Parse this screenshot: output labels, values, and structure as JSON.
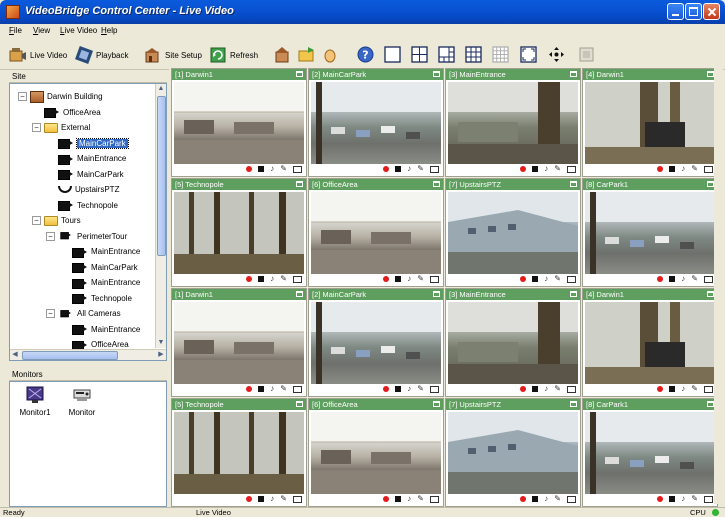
{
  "window": {
    "title": "VideoBridge Control Center - Live Video"
  },
  "menu": [
    {
      "label": "File",
      "underline": "F",
      "rest": "ile"
    },
    {
      "label": "View",
      "underline": "V",
      "rest": "iew"
    },
    {
      "label": "Live Video",
      "underline": "L",
      "rest": "ive Video"
    },
    {
      "label": "Help",
      "underline": "H",
      "rest": "elp"
    }
  ],
  "toolbar": {
    "live_video": "Live Video",
    "playback": "Playback",
    "site_setup": "Site Setup",
    "refresh": "Refresh"
  },
  "site_panel": {
    "header": "Site",
    "tree": [
      {
        "label": "Darwin Building",
        "level": 0,
        "kind": "building",
        "expander": "−"
      },
      {
        "label": "OfficeArea",
        "level": 1,
        "kind": "camera"
      },
      {
        "label": "External",
        "level": 1,
        "kind": "folder",
        "expander": "−"
      },
      {
        "label": "MainCarPark",
        "level": 2,
        "kind": "camera",
        "selected": true
      },
      {
        "label": "MainEntrance",
        "level": 2,
        "kind": "camera"
      },
      {
        "label": "MainCarPark",
        "level": 2,
        "kind": "camera"
      },
      {
        "label": "UpstairsPTZ",
        "level": 2,
        "kind": "ptz"
      },
      {
        "label": "Technopole",
        "level": 2,
        "kind": "camera"
      },
      {
        "label": "Tours",
        "level": 1,
        "kind": "folder",
        "expander": "−"
      },
      {
        "label": "PerimeterTour",
        "level": 2,
        "kind": "tour",
        "expander": "−"
      },
      {
        "label": "MainEntrance",
        "level": 3,
        "kind": "camera"
      },
      {
        "label": "MainCarPark",
        "level": 3,
        "kind": "camera"
      },
      {
        "label": "MainEntrance",
        "level": 3,
        "kind": "camera"
      },
      {
        "label": "Technopole",
        "level": 3,
        "kind": "camera"
      },
      {
        "label": "All Cameras",
        "level": 2,
        "kind": "tour",
        "expander": "−"
      },
      {
        "label": "MainEntrance",
        "level": 3,
        "kind": "camera"
      },
      {
        "label": "OfficeArea",
        "level": 3,
        "kind": "camera"
      }
    ]
  },
  "monitors_panel": {
    "header": "Monitors",
    "items": [
      {
        "label": "Monitor1"
      },
      {
        "label": "Monitor"
      }
    ]
  },
  "tiles": [
    {
      "label": "[1] Darwin1",
      "scene": "office"
    },
    {
      "label": "[2] MainCarPark",
      "scene": "parking"
    },
    {
      "label": "[3] MainEntrance",
      "scene": "entrance"
    },
    {
      "label": "[4] Darwin1",
      "scene": "trees"
    },
    {
      "label": "[5] Technopole",
      "scene": "forest"
    },
    {
      "label": "[6] OfficeArea",
      "scene": "office"
    },
    {
      "label": "[7] UpstairsPTZ",
      "scene": "building"
    },
    {
      "label": "[8] CarPark1",
      "scene": "parking"
    },
    {
      "label": "[1] Darwin1",
      "scene": "office"
    },
    {
      "label": "[2] MainCarPark",
      "scene": "parking"
    },
    {
      "label": "[3] MainEntrance",
      "scene": "entrance"
    },
    {
      "label": "[4] Darwin1",
      "scene": "trees"
    },
    {
      "label": "[5] Technopole",
      "scene": "forest"
    },
    {
      "label": "[6] OfficeArea",
      "scene": "office"
    },
    {
      "label": "[7] UpstairsPTZ",
      "scene": "building"
    },
    {
      "label": "[8] CarPark1",
      "scene": "parking"
    }
  ],
  "statusbar": {
    "left": "Ready",
    "center": "Live Video",
    "right": "CPU"
  },
  "colors": {
    "title_blue": "#0a5bdc",
    "tile_header": "#5e9e5e",
    "record_red": "#e21b1b",
    "cpu_green": "#2fb52f"
  }
}
